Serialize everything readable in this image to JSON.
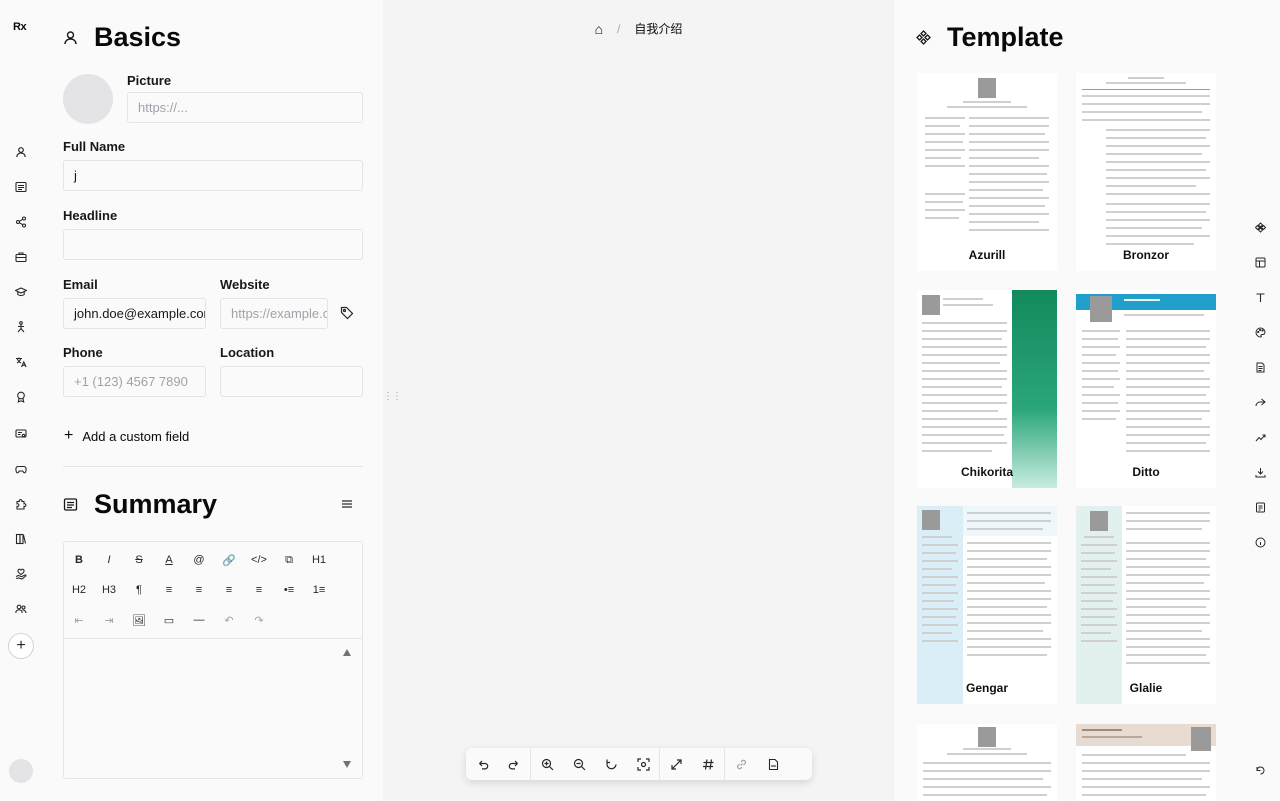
{
  "app": {
    "logo": "Rx"
  },
  "left_rail": {
    "icons": [
      "user-icon",
      "summary-icon",
      "profiles-icon",
      "briefcase-icon",
      "graduation-cap-icon",
      "skills-icon",
      "languages-icon",
      "award-icon",
      "certificate-icon",
      "gamepad-icon",
      "puzzle-icon",
      "publications-icon",
      "volunteer-icon",
      "users-icon"
    ],
    "add_label": "+"
  },
  "basics": {
    "title": "Basics",
    "picture_label": "Picture",
    "picture_placeholder": "https://...",
    "full_name_label": "Full Name",
    "full_name_value": "j",
    "headline_label": "Headline",
    "headline_value": "",
    "email_label": "Email",
    "email_value": "john.doe@example.com",
    "website_label": "Website",
    "website_placeholder": "https://example.com",
    "phone_label": "Phone",
    "phone_placeholder": "+1 (123) 4567 7890",
    "location_label": "Location",
    "location_value": "",
    "add_custom_field": "Add a custom field"
  },
  "summary": {
    "title": "Summary",
    "toolbar_row1": [
      "B",
      "I",
      "S",
      "A",
      "@",
      "🔗",
      "</>",
      "⧉",
      "H1"
    ],
    "toolbar_row2": [
      "H2",
      "H3",
      "¶",
      "≡",
      "≡",
      "≡",
      "≡",
      "•≡",
      "1≡"
    ],
    "toolbar_row3": [
      "⇤",
      "⇥",
      "🖼",
      "▭",
      "—",
      "↶",
      "↷"
    ]
  },
  "center": {
    "breadcrumb_home": "⌂",
    "breadcrumb_sep": "/",
    "breadcrumb_title": "自我介绍",
    "toolbar": [
      "undo",
      "redo",
      "zoom-in",
      "zoom-out",
      "reset-zoom",
      "center",
      "fullscreen",
      "grid",
      "link",
      "pdf"
    ]
  },
  "template": {
    "title": "Template",
    "items": [
      "Azurill",
      "Bronzor",
      "Chikorita",
      "Ditto",
      "Gengar",
      "Glalie",
      "",
      ""
    ]
  },
  "right_rail": {
    "icons": [
      "template-icon",
      "layout-icon",
      "typography-icon",
      "theme-icon",
      "page-icon",
      "share-icon",
      "statistics-icon",
      "export-icon",
      "notes-icon",
      "information-icon",
      "reset-icon"
    ]
  },
  "colors": {
    "chikorita_accent": "#1a9b6b",
    "ditto_accent": "#1f9fc9",
    "gengar_accent": "#d9eef7",
    "glalie_accent": "#e3f0f0"
  }
}
